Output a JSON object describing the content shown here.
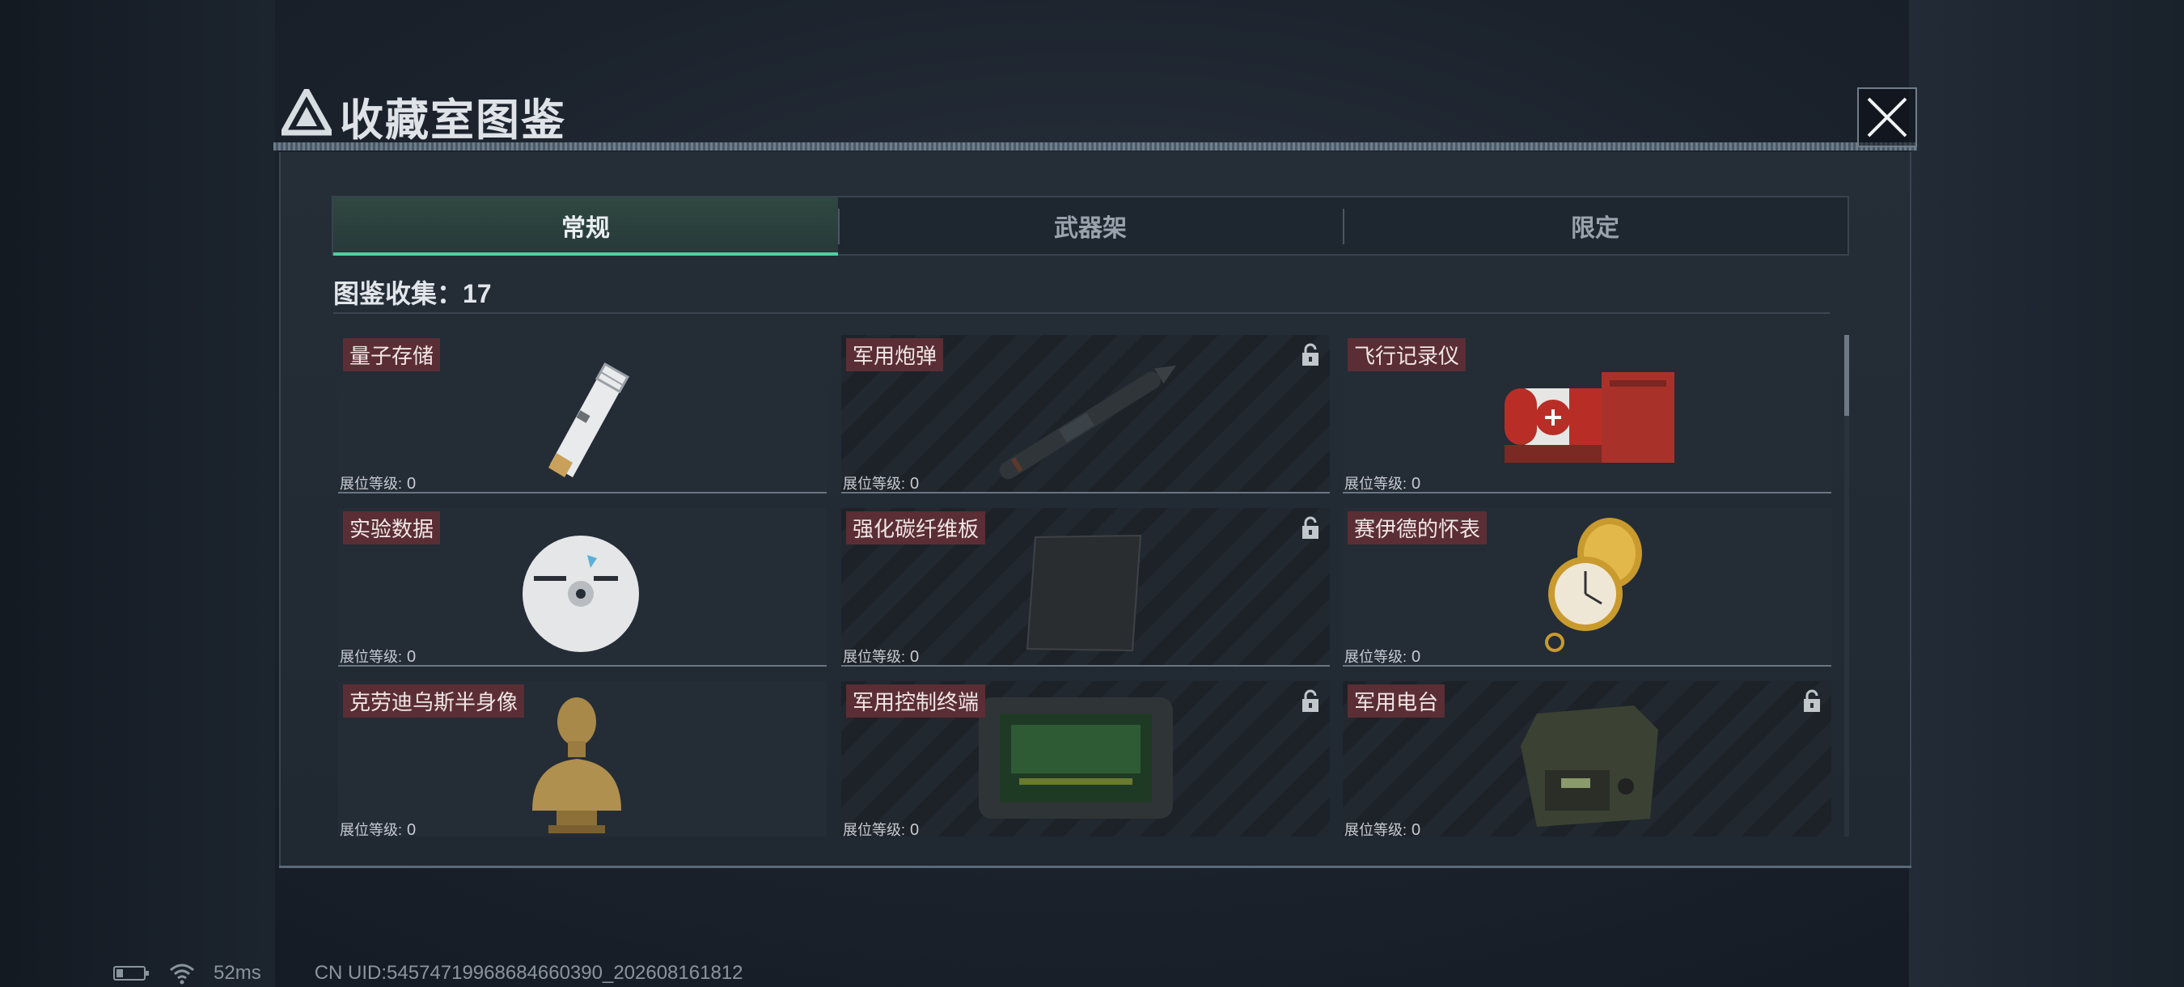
{
  "window": {
    "title": "收藏室图鉴",
    "close_icon": "close-icon"
  },
  "tabs": [
    {
      "label": "常规",
      "active": true
    },
    {
      "label": "武器架",
      "active": false
    },
    {
      "label": "限定",
      "active": false
    }
  ],
  "collection": {
    "label": "图鉴收集：17"
  },
  "items": [
    {
      "name": "量子存储",
      "level_label": "展位等级:",
      "level": "0",
      "locked": false,
      "icon": "usb-drive-icon"
    },
    {
      "name": "军用炮弹",
      "level_label": "展位等级:",
      "level": "0",
      "locked": true,
      "icon": "artillery-shell-icon"
    },
    {
      "name": "飞行记录仪",
      "level_label": "展位等级:",
      "level": "0",
      "locked": false,
      "icon": "flight-recorder-icon"
    },
    {
      "name": "实验数据",
      "level_label": "展位等级:",
      "level": "0",
      "locked": false,
      "icon": "disc-icon"
    },
    {
      "name": "强化碳纤维板",
      "level_label": "展位等级:",
      "level": "0",
      "locked": true,
      "icon": "carbon-plate-icon"
    },
    {
      "name": "赛伊德的怀表",
      "level_label": "展位等级:",
      "level": "0",
      "locked": false,
      "icon": "pocket-watch-icon"
    },
    {
      "name": "克劳迪乌斯半身像",
      "level_label": "展位等级:",
      "level": "0",
      "locked": false,
      "icon": "bust-icon"
    },
    {
      "name": "军用控制终端",
      "level_label": "展位等级:",
      "level": "0",
      "locked": true,
      "icon": "control-terminal-icon"
    },
    {
      "name": "军用电台",
      "level_label": "展位等级:",
      "level": "0",
      "locked": true,
      "icon": "radio-icon"
    }
  ],
  "status_bar": {
    "ping": "52ms",
    "uid": "CN UID:5457471996868466039​0_202608161812"
  }
}
